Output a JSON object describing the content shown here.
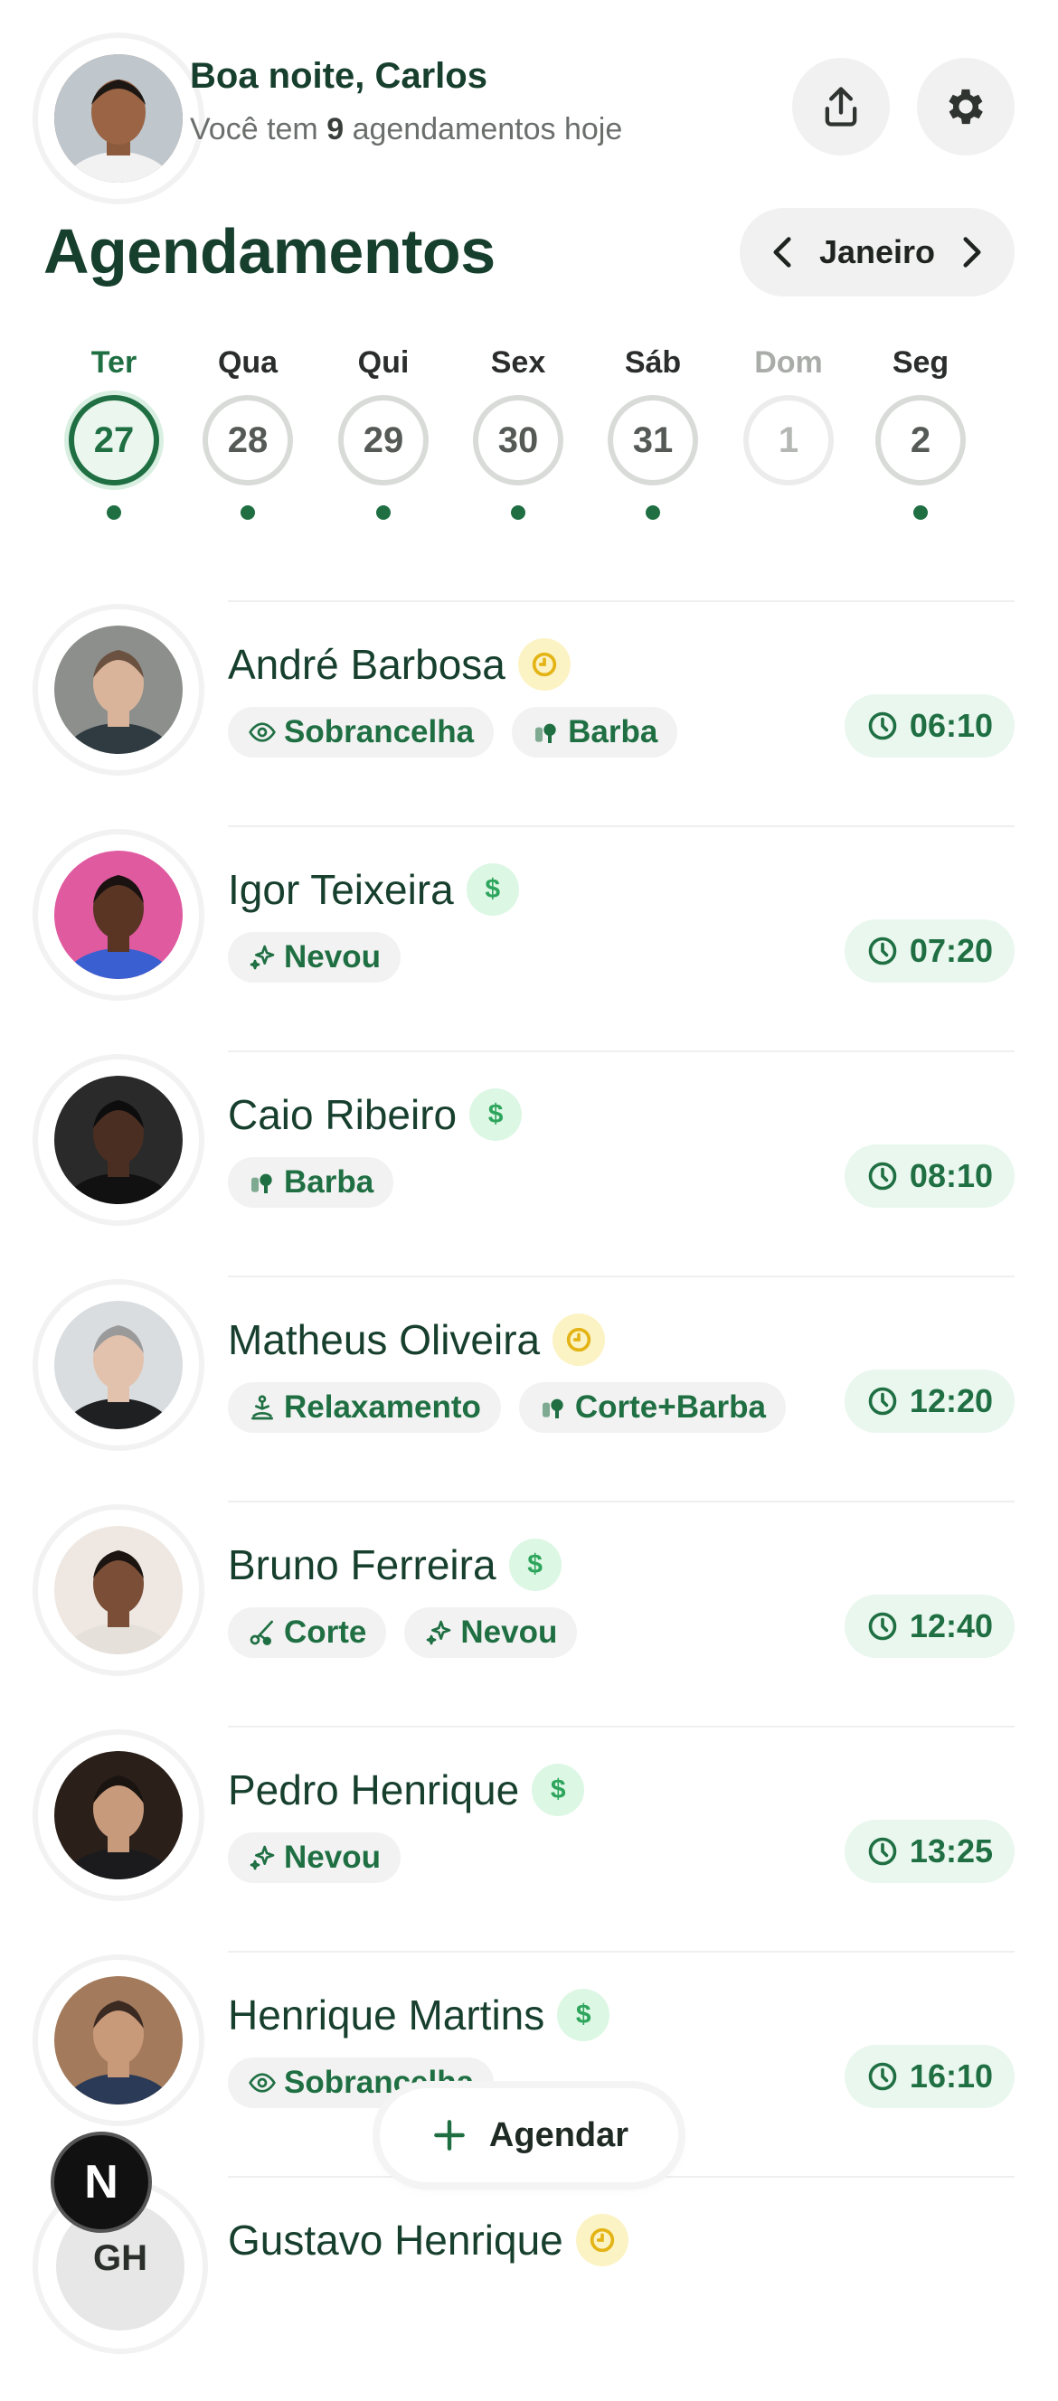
{
  "header": {
    "greeting": "Boa noite, Carlos",
    "subtitle_prefix": "Você tem ",
    "subtitle_count": "9",
    "subtitle_suffix": " agendamentos hoje",
    "share_icon": "share-icon",
    "settings_icon": "gear-icon"
  },
  "section": {
    "title": "Agendamentos",
    "month": "Janeiro"
  },
  "calendar": {
    "days": [
      {
        "name": "Ter",
        "num": "27",
        "state": "active",
        "has_dot": true
      },
      {
        "name": "Qua",
        "num": "28",
        "state": "normal",
        "has_dot": true
      },
      {
        "name": "Qui",
        "num": "29",
        "state": "normal",
        "has_dot": true
      },
      {
        "name": "Sex",
        "num": "30",
        "state": "normal",
        "has_dot": true
      },
      {
        "name": "Sáb",
        "num": "31",
        "state": "normal",
        "has_dot": true
      },
      {
        "name": "Dom",
        "num": "1",
        "state": "dim",
        "has_dot": false
      },
      {
        "name": "Seg",
        "num": "2",
        "state": "normal",
        "has_dot": true
      }
    ]
  },
  "appointments": [
    {
      "name": "André Barbosa",
      "status": "pending",
      "time": "06:10",
      "tags": [
        {
          "icon": "eye-icon",
          "label": "Sobrancelha"
        },
        {
          "icon": "beard-icon",
          "label": "Barba"
        }
      ]
    },
    {
      "name": "Igor Teixeira",
      "status": "paid",
      "time": "07:20",
      "tags": [
        {
          "icon": "sparkle-icon",
          "label": "Nevou"
        }
      ]
    },
    {
      "name": "Caio Ribeiro",
      "status": "paid",
      "time": "08:10",
      "tags": [
        {
          "icon": "beard-icon",
          "label": "Barba"
        }
      ]
    },
    {
      "name": "Matheus Oliveira",
      "status": "pending",
      "time": "12:20",
      "tags": [
        {
          "icon": "relax-icon",
          "label": "Relaxamento"
        },
        {
          "icon": "beard-icon",
          "label": "Corte+Barba"
        }
      ]
    },
    {
      "name": "Bruno Ferreira",
      "status": "paid",
      "time": "12:40",
      "tags": [
        {
          "icon": "scissors-icon",
          "label": "Corte"
        },
        {
          "icon": "sparkle-icon",
          "label": "Nevou"
        }
      ]
    },
    {
      "name": "Pedro Henrique",
      "status": "paid",
      "time": "13:25",
      "tags": [
        {
          "icon": "sparkle-icon",
          "label": "Nevou"
        }
      ]
    },
    {
      "name": "Henrique Martins",
      "status": "paid",
      "time": "16:10",
      "tags": [
        {
          "icon": "eye-icon",
          "label": "Sobrancelha"
        }
      ]
    },
    {
      "name": "Gustavo Henrique",
      "status": "pending",
      "time": "",
      "initials": "GH",
      "tags": []
    }
  ],
  "fab": {
    "label": "Agendar"
  },
  "dev_badge": {
    "letter": "N"
  },
  "colors": {
    "primary": "#1f6f43",
    "dark_text": "#173f2d",
    "pending_badge": "#fcf3c4",
    "paid_badge": "#dcf7e4",
    "pill_bg": "#f1f2f1"
  }
}
